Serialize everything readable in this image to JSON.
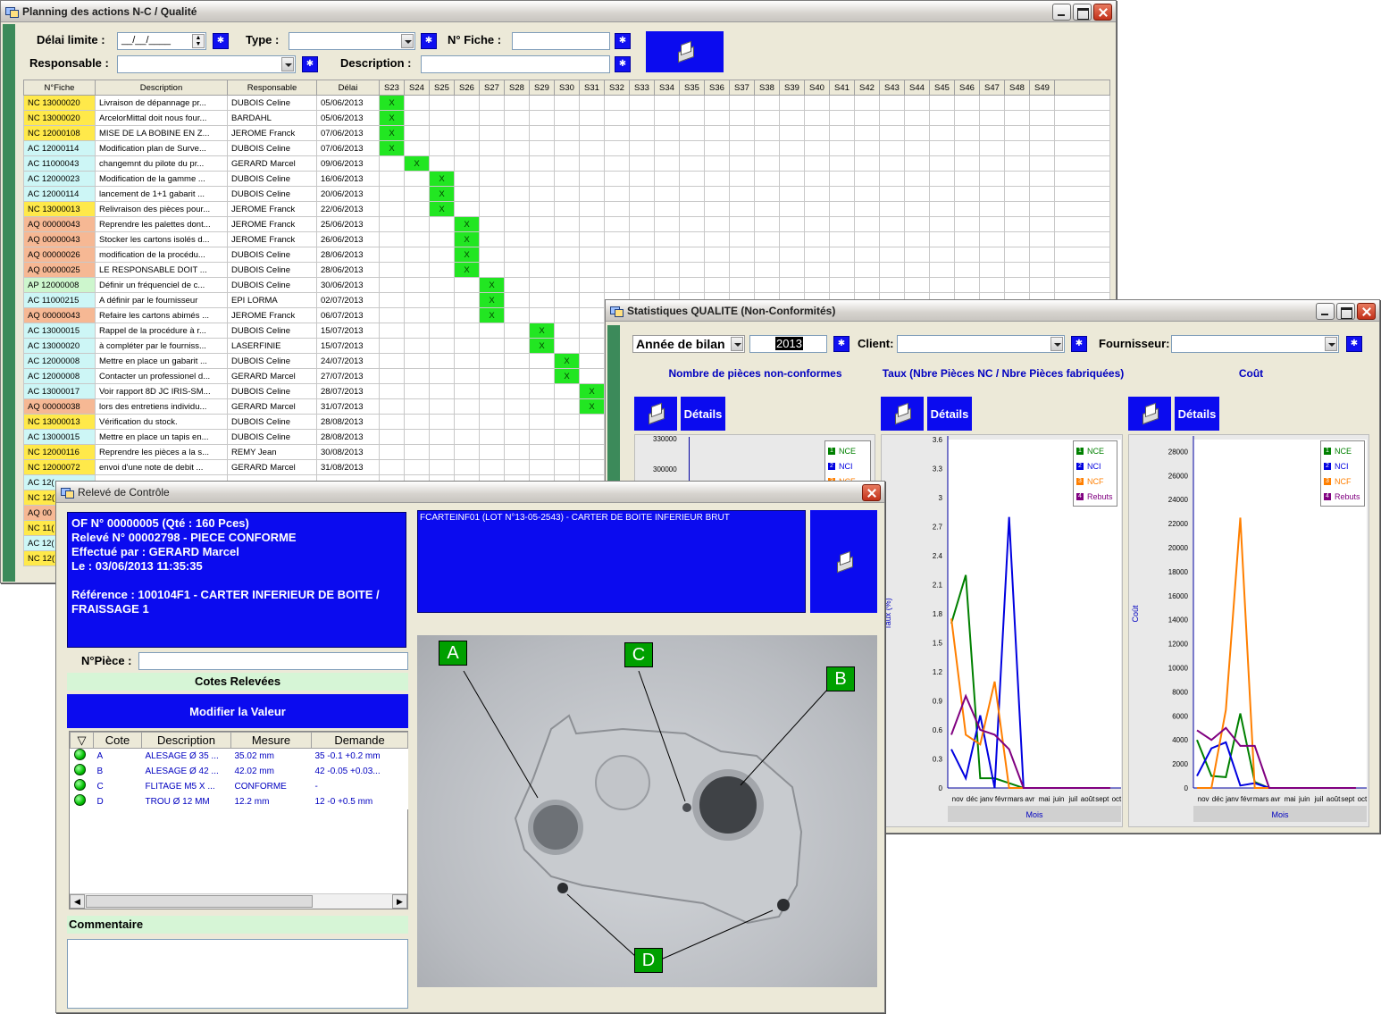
{
  "planning": {
    "title": "Planning des actions N-C / Qualité",
    "filters": {
      "delai_label": "Délai limite :",
      "delai_value": "__/__/____",
      "type_label": "Type :",
      "fiche_label": "N° Fiche :",
      "responsable_label": "Responsable :",
      "description_label": "Description :"
    },
    "columns": [
      "N°Fiche",
      "Description",
      "Responsable",
      "Délai"
    ],
    "weeks": [
      "S23",
      "S24",
      "S25",
      "S26",
      "S27",
      "S28",
      "S29",
      "S30",
      "S31",
      "S32",
      "S33",
      "S34",
      "S35",
      "S36",
      "S37",
      "S38",
      "S39",
      "S40",
      "S41",
      "S42",
      "S43",
      "S44",
      "S45",
      "S46",
      "S47",
      "S48",
      "S49"
    ],
    "rows": [
      {
        "type": "NC",
        "fiche": "NC 13000020",
        "desc": "Livraison de dépannage pr...",
        "resp": "DUBOIS Celine",
        "delai": "05/06/2013",
        "wk": 0
      },
      {
        "type": "NC",
        "fiche": "NC 13000020",
        "desc": "ArcelorMittal doit nous four...",
        "resp": "BARDAHL",
        "delai": "05/06/2013",
        "wk": 0
      },
      {
        "type": "NC",
        "fiche": "NC 12000108",
        "desc": "MISE DE LA BOBINE EN Z...",
        "resp": "JEROME Franck",
        "delai": "07/06/2013",
        "wk": 0
      },
      {
        "type": "AC",
        "fiche": "AC 12000114",
        "desc": "Modification plan de Surve...",
        "resp": "DUBOIS Celine",
        "delai": "07/06/2013",
        "wk": 0
      },
      {
        "type": "AC",
        "fiche": "AC 11000043",
        "desc": "changemnt du pilote du pr...",
        "resp": "GERARD Marcel",
        "delai": "09/06/2013",
        "wk": 1
      },
      {
        "type": "AC",
        "fiche": "AC 12000023",
        "desc": "Modification de la gamme ...",
        "resp": "DUBOIS Celine",
        "delai": "16/06/2013",
        "wk": 2
      },
      {
        "type": "AC",
        "fiche": "AC 12000114",
        "desc": "lancement de 1+1 gabarit ...",
        "resp": "DUBOIS Celine",
        "delai": "20/06/2013",
        "wk": 2
      },
      {
        "type": "NC",
        "fiche": "NC 13000013",
        "desc": "Relivraison des pièces pour...",
        "resp": "JEROME Franck",
        "delai": "22/06/2013",
        "wk": 2
      },
      {
        "type": "AQ",
        "fiche": "AQ 00000043",
        "desc": "Reprendre les palettes dont...",
        "resp": "JEROME Franck",
        "delai": "25/06/2013",
        "wk": 3
      },
      {
        "type": "AQ",
        "fiche": "AQ 00000043",
        "desc": "Stocker les cartons isolés d...",
        "resp": "JEROME Franck",
        "delai": "26/06/2013",
        "wk": 3
      },
      {
        "type": "AQ",
        "fiche": "AQ 00000026",
        "desc": "modification de la procédu...",
        "resp": "DUBOIS Celine",
        "delai": "28/06/2013",
        "wk": 3
      },
      {
        "type": "AQ",
        "fiche": "AQ 00000025",
        "desc": "LE RESPONSABLE DOIT ...",
        "resp": "DUBOIS Celine",
        "delai": "28/06/2013",
        "wk": 3
      },
      {
        "type": "AP",
        "fiche": "AP 12000008",
        "desc": "Définir un fréquenciel de c...",
        "resp": "DUBOIS Celine",
        "delai": "30/06/2013",
        "wk": 4
      },
      {
        "type": "AC",
        "fiche": "AC 11000215",
        "desc": "A définir par le fournisseur",
        "resp": "EPI LORMA",
        "delai": "02/07/2013",
        "wk": 4
      },
      {
        "type": "AQ",
        "fiche": "AQ 00000043",
        "desc": "Refaire les cartons abimés ...",
        "resp": "JEROME Franck",
        "delai": "06/07/2013",
        "wk": 4
      },
      {
        "type": "AC",
        "fiche": "AC 13000015",
        "desc": "Rappel de la procédure à r...",
        "resp": "DUBOIS Celine",
        "delai": "15/07/2013",
        "wk": 6
      },
      {
        "type": "AC",
        "fiche": "AC 13000020",
        "desc": "à compléter par le fourniss...",
        "resp": "LASERFINIE",
        "delai": "15/07/2013",
        "wk": 6
      },
      {
        "type": "AC",
        "fiche": "AC 12000008",
        "desc": "Mettre en place un gabarit ...",
        "resp": "DUBOIS Celine",
        "delai": "24/07/2013",
        "wk": 7
      },
      {
        "type": "AC",
        "fiche": "AC 12000008",
        "desc": "Contacter un professionel d...",
        "resp": "GERARD Marcel",
        "delai": "27/07/2013",
        "wk": 7
      },
      {
        "type": "AC",
        "fiche": "AC 13000017",
        "desc": "Voir rapport 8D JC IRIS-SM...",
        "resp": "DUBOIS Celine",
        "delai": "28/07/2013",
        "wk": 8
      },
      {
        "type": "AQ",
        "fiche": "AQ 00000038",
        "desc": "lors des entretiens individu...",
        "resp": "GERARD Marcel",
        "delai": "31/07/2013",
        "wk": 8
      },
      {
        "type": "NC",
        "fiche": "NC 13000013",
        "desc": "Vérification du stock.",
        "resp": "DUBOIS Celine",
        "delai": "28/08/2013",
        "wk": -1
      },
      {
        "type": "AC",
        "fiche": "AC 13000015",
        "desc": "Mettre en place un tapis en...",
        "resp": "DUBOIS Celine",
        "delai": "28/08/2013",
        "wk": -1
      },
      {
        "type": "NC",
        "fiche": "NC 12000116",
        "desc": "Reprendre les pièces a la s...",
        "resp": "REMY Jean",
        "delai": "30/08/2013",
        "wk": -1
      },
      {
        "type": "NC",
        "fiche": "NC 12000072",
        "desc": "envoi d'une note de debit ...",
        "resp": "GERARD Marcel",
        "delai": "31/08/2013",
        "wk": -1
      },
      {
        "type": "AC",
        "fiche": "AC 12(",
        "desc": "",
        "resp": "",
        "delai": "",
        "wk": -1
      },
      {
        "type": "NC",
        "fiche": "NC 12(",
        "desc": "",
        "resp": "",
        "delai": "",
        "wk": -1
      },
      {
        "type": "AQ",
        "fiche": "AQ 00",
        "desc": "",
        "resp": "",
        "delai": "",
        "wk": -1
      },
      {
        "type": "NC",
        "fiche": "NC 11(",
        "desc": "",
        "resp": "",
        "delai": "",
        "wk": -1
      },
      {
        "type": "AC",
        "fiche": "AC 12(",
        "desc": "",
        "resp": "",
        "delai": "",
        "wk": -1
      },
      {
        "type": "NC",
        "fiche": "NC 12(",
        "desc": "",
        "resp": "",
        "delai": "",
        "wk": -1
      }
    ],
    "check_mark": "X"
  },
  "stats": {
    "title": "Statistiques QUALITE (Non-Conformités)",
    "annee_label": "Année de bilan",
    "annee_value": "2013",
    "client_label": "Client:",
    "fournisseur_label": "Fournisseur:",
    "panel_titles": [
      "Nombre de pièces non-conformes",
      "Taux (Nbre Pièces NC / Nbre Pièces fabriquées)",
      "Coût"
    ],
    "details_label": "Détails",
    "legend_items": [
      "NCE",
      "NCI",
      "NCF",
      "Rebuts"
    ],
    "legend_colors": [
      "#008000",
      "#0000e0",
      "#ff7f00",
      "#800080"
    ],
    "months": [
      "nov",
      "déc",
      "janv",
      "févr",
      "mars",
      "avr",
      "mai",
      "juin",
      "juil",
      "août",
      "sept",
      "oct"
    ],
    "xlabel": "Mois",
    "taux_ylabel": "Taux (%)",
    "cout_ylabel": "Coût",
    "chart1_ticks": [
      "330000",
      "300000"
    ]
  },
  "chart_data": [
    {
      "type": "line",
      "title": "Taux (Nbre Pièces NC / Nbre Pièces fabriquées)",
      "xlabel": "Mois",
      "ylabel": "Taux (%)",
      "ylim": [
        0,
        3.6
      ],
      "yticks": [
        "0",
        "0.3",
        "0.6",
        "0.9",
        "1.2",
        "1.5",
        "1.8",
        "2.1",
        "2.4",
        "2.7",
        "3",
        "3.3",
        "3.6"
      ],
      "x": [
        "nov",
        "déc",
        "janv",
        "févr",
        "mars",
        "avr",
        "mai",
        "juin",
        "juil",
        "août",
        "sept",
        "oct"
      ],
      "series": [
        {
          "name": "NCE",
          "color": "#008000",
          "values": [
            1.7,
            2.2,
            0.1,
            0.1,
            0.05,
            0,
            0,
            0,
            0,
            0,
            0,
            0
          ]
        },
        {
          "name": "NCI",
          "color": "#0000e0",
          "values": [
            0.4,
            0.1,
            0.75,
            0.0,
            2.8,
            0,
            0,
            0,
            0,
            0,
            0,
            0
          ]
        },
        {
          "name": "NCF",
          "color": "#ff7f00",
          "values": [
            1.75,
            0.55,
            0.45,
            1.1,
            0.0,
            0,
            0,
            0,
            0,
            0,
            0,
            0
          ]
        },
        {
          "name": "Rebuts",
          "color": "#800080",
          "values": [
            0.55,
            0.95,
            0.6,
            0.55,
            0.4,
            0,
            0,
            0,
            0,
            0,
            0,
            0
          ]
        }
      ]
    },
    {
      "type": "line",
      "title": "Coût",
      "xlabel": "Mois",
      "ylabel": "Coût",
      "ylim": [
        0,
        29000
      ],
      "yticks": [
        "0",
        "2000",
        "4000",
        "6000",
        "8000",
        "10000",
        "12000",
        "14000",
        "16000",
        "18000",
        "20000",
        "22000",
        "24000",
        "26000",
        "28000"
      ],
      "x": [
        "nov",
        "déc",
        "janv",
        "févr",
        "mars",
        "avr",
        "mai",
        "juin",
        "juil",
        "août",
        "sept",
        "oct"
      ],
      "series": [
        {
          "name": "NCE",
          "color": "#008000",
          "values": [
            4000,
            1000,
            900,
            6200,
            500,
            0,
            0,
            0,
            0,
            0,
            0,
            0
          ]
        },
        {
          "name": "NCI",
          "color": "#0000e0",
          "values": [
            1000,
            3300,
            3800,
            200,
            400,
            0,
            0,
            0,
            0,
            0,
            0,
            0
          ]
        },
        {
          "name": "NCF",
          "color": "#ff7f00",
          "values": [
            0,
            0,
            6500,
            22500,
            0,
            0,
            0,
            0,
            0,
            0,
            0,
            0
          ]
        },
        {
          "name": "Rebuts",
          "color": "#800080",
          "values": [
            4800,
            4000,
            5000,
            3500,
            3500,
            0,
            0,
            0,
            0,
            0,
            0,
            0
          ]
        }
      ]
    }
  ],
  "releve": {
    "title": "Relevé de Contrôle",
    "info_lines": [
      "OF N° 00000005 (Qté : 160 Pces)",
      "Relevé N° 00002798 - PIECE CONFORME",
      "Effectué par : GERARD Marcel",
      "Le : 03/06/2013 11:35:35",
      "",
      "Référence : 100104F1 - CARTER INFERIEUR DE BOITE /",
      "FRAISSAGE 1"
    ],
    "part_text": "FCARTEINF01 (LOT N°13-05-2543) - CARTER DE BOITE INFERIEUR BRUT",
    "npiece_label": "N°Pièce :",
    "cotes_header": "Cotes Relevées",
    "modifier_label": "Modifier la Valeur",
    "table_headers": [
      "Cote",
      "Description",
      "Mesure",
      "Demande"
    ],
    "table_rows": [
      {
        "cote": "A",
        "desc": "ALESAGE Ø 35 ...",
        "mesure": "35.02 mm",
        "demande": "35 -0.1 +0.2 mm"
      },
      {
        "cote": "B",
        "desc": "ALESAGE Ø 42 ...",
        "mesure": "42.02 mm",
        "demande": "42 -0.05 +0.03..."
      },
      {
        "cote": "C",
        "desc": "FLITAGE M5 X ...",
        "mesure": "CONFORME",
        "demande": "-"
      },
      {
        "cote": "D",
        "desc": "TROU Ø 12 MM",
        "mesure": "12.2 mm",
        "demande": "12 -0 +0.5 mm"
      }
    ],
    "commentaire_label": "Commentaire",
    "markers": [
      "A",
      "B",
      "C",
      "D"
    ]
  }
}
